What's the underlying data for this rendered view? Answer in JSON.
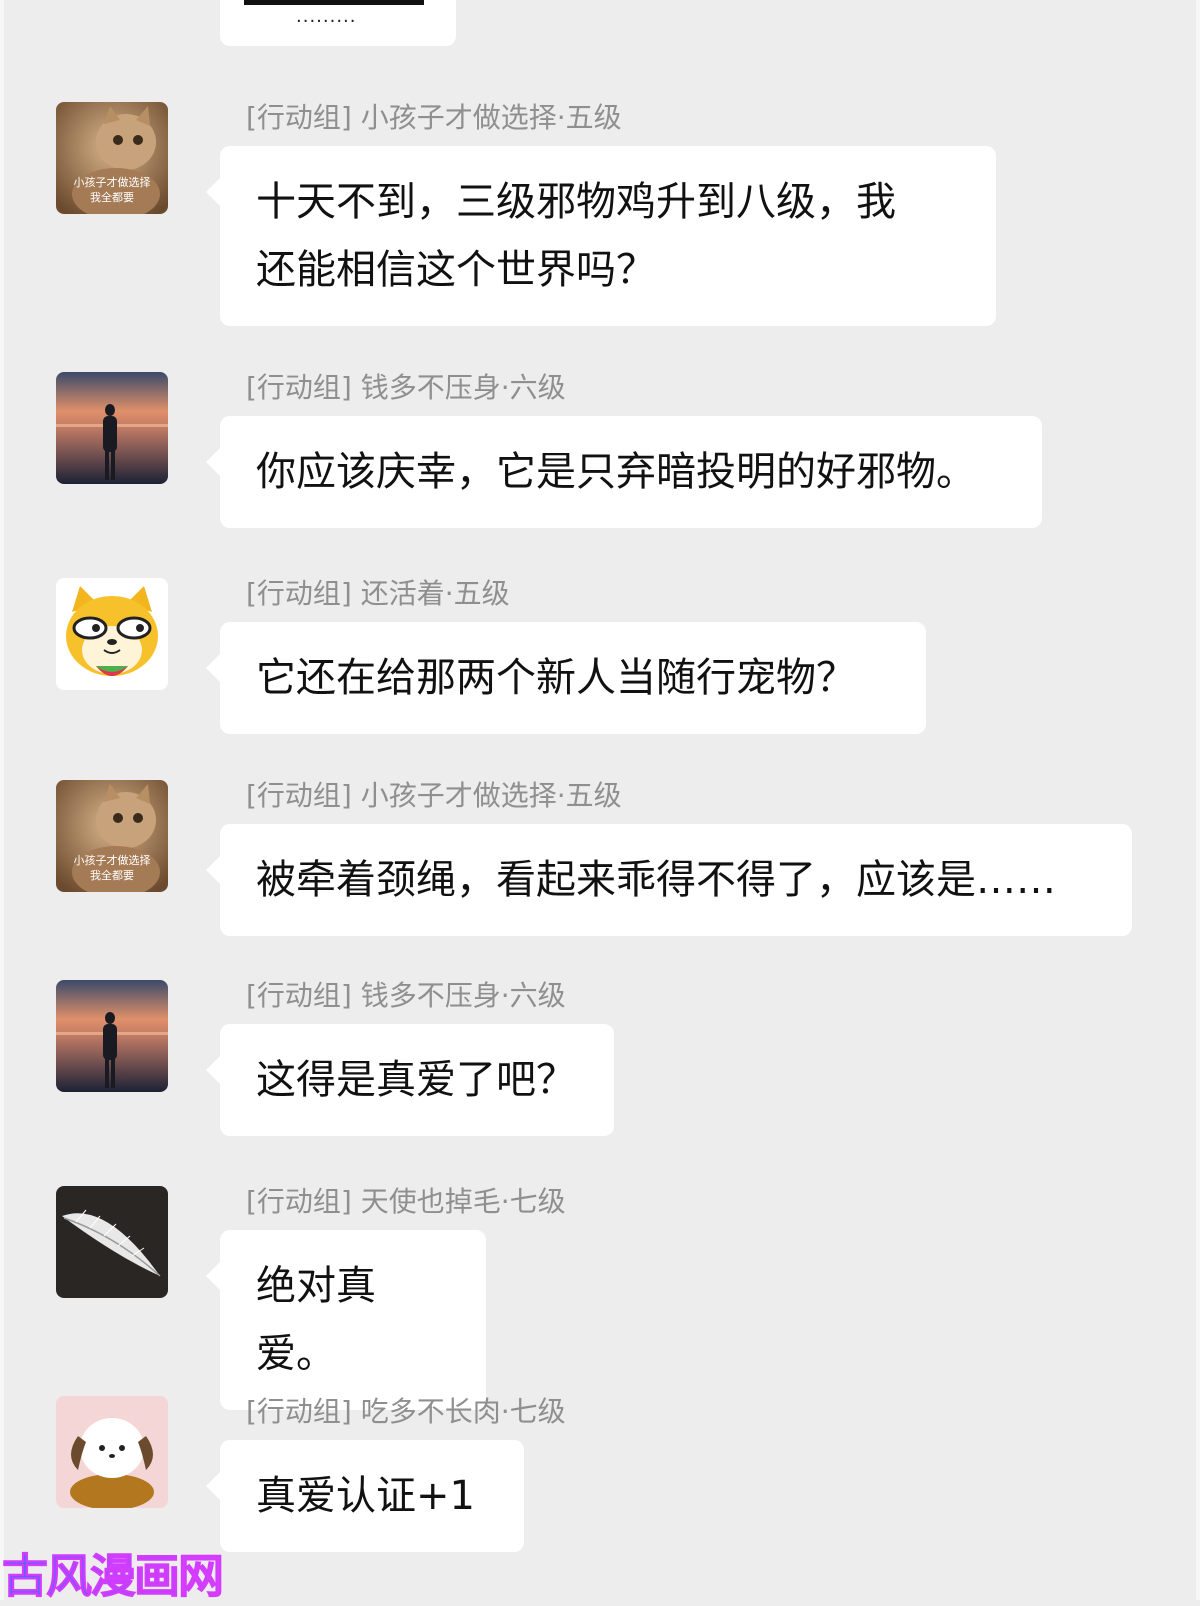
{
  "top_bubble": {
    "dots": "........."
  },
  "messages": [
    {
      "sender": "[行动组] 小孩子才做选择·五级",
      "avatar": "cat-avatar-icon",
      "avatar_caption": "小孩子才做选择\n我全都要",
      "text": "十天不到，三级邪物鸡升到八级，我\n还能相信这个世界吗？"
    },
    {
      "sender": "[行动组] 钱多不压身·六级",
      "avatar": "sunset-silhouette-avatar-icon",
      "text": "你应该庆幸，它是只弃暗投明的好邪物。"
    },
    {
      "sender": "[行动组] 还活着·五级",
      "avatar": "shiba-meme-avatar-icon",
      "text": "它还在给那两个新人当随行宠物？"
    },
    {
      "sender": "[行动组] 小孩子才做选择·五级",
      "avatar": "cat-avatar-icon",
      "avatar_caption": "小孩子才做选择\n我全都要",
      "text": "被牵着颈绳，看起来乖得不得了，应该是……"
    },
    {
      "sender": "[行动组] 钱多不压身·六级",
      "avatar": "sunset-silhouette-avatar-icon",
      "text": "这得是真爱了吧？"
    },
    {
      "sender": "[行动组] 天使也掉毛·七级",
      "avatar": "feather-avatar-icon",
      "text": "绝对真爱。"
    },
    {
      "sender": "[行动组] 吃多不长肉·七级",
      "avatar": "puppy-cake-avatar-icon",
      "text": "真爱认证+1"
    }
  ],
  "watermark": [
    "古",
    "风",
    "漫",
    "画",
    "网"
  ]
}
